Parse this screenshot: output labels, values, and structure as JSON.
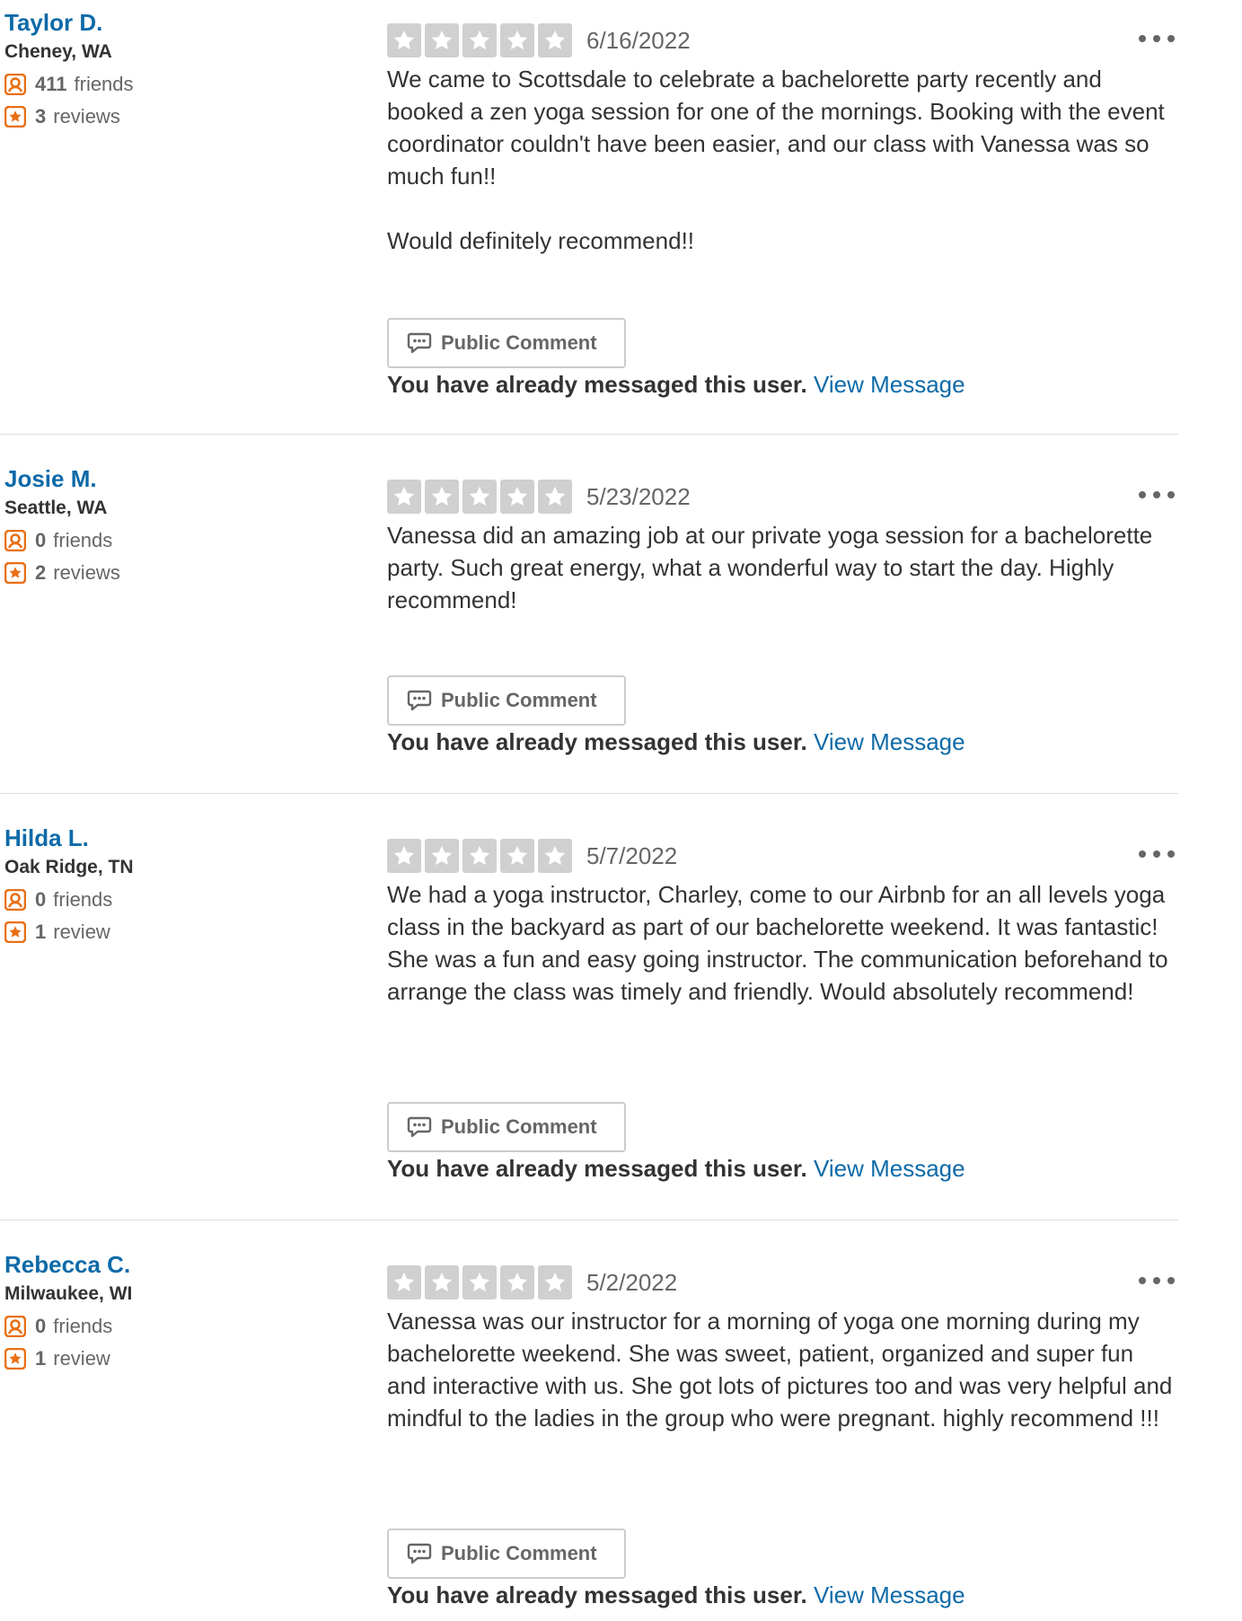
{
  "colors": {
    "link": "#0d6aa8",
    "star_inactive": "#d0d0d0",
    "icon_orange": "#e96f14",
    "text_muted": "#666666"
  },
  "icons": {
    "friends": "friends-icon",
    "reviews": "star-badge-icon",
    "rating_star": "star-icon",
    "comment": "speech-bubble-icon",
    "more": "ellipsis-icon"
  },
  "labels": {
    "public_comment": "Public Comment",
    "messaged_notice": "You have already messaged this user.",
    "view_message": "View Message"
  },
  "reviews": [
    {
      "name": "Taylor D.",
      "location": "Cheney, WA",
      "friends_count": "411",
      "friends_label": "friends",
      "reviews_count": "3",
      "reviews_label": "reviews",
      "rating": 5,
      "date": "6/16/2022",
      "text": "We came to Scottsdale to celebrate a bachelorette party recently and booked a zen yoga session for one of the mornings. Booking with the event coordinator couldn't have been easier, and our class with Vanessa was so much fun!!\n\nWould definitely recommend!!"
    },
    {
      "name": "Josie M.",
      "location": "Seattle, WA",
      "friends_count": "0",
      "friends_label": "friends",
      "reviews_count": "2",
      "reviews_label": "reviews",
      "rating": 5,
      "date": "5/23/2022",
      "text": "Vanessa did an amazing job at our private yoga session for a bachelorette party. Such great energy, what a wonderful way to start the day. Highly recommend!"
    },
    {
      "name": "Hilda L.",
      "location": "Oak Ridge, TN",
      "friends_count": "0",
      "friends_label": "friends",
      "reviews_count": "1",
      "reviews_label": "review",
      "rating": 5,
      "date": "5/7/2022",
      "text": "We had a yoga instructor, Charley, come to our Airbnb for an all levels yoga class in the backyard as part of our bachelorette weekend. It was fantastic! She was a fun and easy going instructor. The communication beforehand to arrange the class was timely and friendly. Would absolutely recommend!"
    },
    {
      "name": "Rebecca C.",
      "location": "Milwaukee, WI",
      "friends_count": "0",
      "friends_label": "friends",
      "reviews_count": "1",
      "reviews_label": "review",
      "rating": 5,
      "date": "5/2/2022",
      "text": "Vanessa was our instructor for a morning of yoga one morning during my bachelorette weekend. She was sweet, patient, organized and super fun and interactive with us. She got lots of pictures too and was very helpful and mindful to the ladies in the group who were pregnant. highly recommend !!!"
    }
  ]
}
